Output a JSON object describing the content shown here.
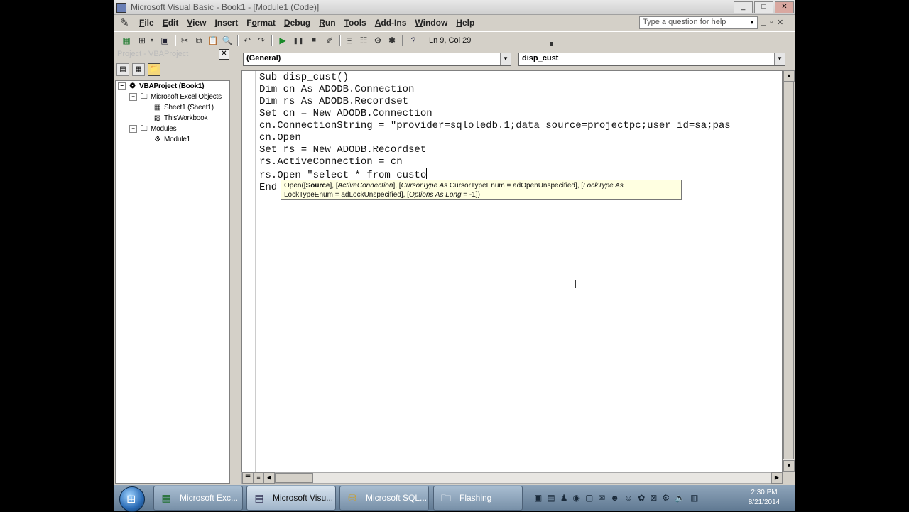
{
  "window": {
    "title": "Microsoft Visual Basic - Book1 - [Module1 (Code)]",
    "controls": [
      "_",
      "□",
      "✕"
    ]
  },
  "menu": {
    "items": [
      {
        "label": "File",
        "key": "F",
        "rest": "ile"
      },
      {
        "label": "Edit",
        "key": "E",
        "rest": "dit"
      },
      {
        "label": "View",
        "key": "V",
        "rest": "iew"
      },
      {
        "label": "Insert",
        "key": "I",
        "rest": "nsert"
      },
      {
        "label": "Format",
        "key": "o",
        "pre": "F",
        "rest": "rmat"
      },
      {
        "label": "Debug",
        "key": "D",
        "rest": "ebug"
      },
      {
        "label": "Run",
        "key": "R",
        "rest": "un"
      },
      {
        "label": "Tools",
        "key": "T",
        "rest": "ools"
      },
      {
        "label": "Add-Ins",
        "key": "A",
        "rest": "dd-Ins"
      },
      {
        "label": "Window",
        "key": "W",
        "rest": "indow"
      },
      {
        "label": "Help",
        "key": "H",
        "rest": "elp"
      }
    ],
    "ask_placeholder": "Type a question for help",
    "mdi_controls": [
      "_",
      "▫",
      "✕"
    ]
  },
  "toolbar": {
    "position": "Ln 9, Col 29"
  },
  "project": {
    "header": "Project - VBAProject",
    "tree": {
      "root": "VBAProject (Book1)",
      "excel_objects": "Microsoft Excel Objects",
      "sheet1": "Sheet1 (Sheet1)",
      "thisworkbook": "ThisWorkbook",
      "modules": "Modules",
      "module1": "Module1"
    }
  },
  "code": {
    "object_combo": "(General)",
    "procedure_combo": "disp_cust",
    "lines": [
      "Sub disp_cust()",
      "Dim cn As ADODB.Connection",
      "Dim rs As ADODB.Recordset",
      "Set cn = New ADODB.Connection",
      "cn.ConnectionString = \"provider=sqloledb.1;data source=projectpc;user id=sa;pas",
      "cn.Open",
      "Set rs = New ADODB.Recordset",
      "rs.ActiveConnection = cn",
      "rs.Open \"select * from custo",
      "End"
    ],
    "tooltip": {
      "p1": "Open([",
      "source": "Source",
      "p2": "], [",
      "active": "ActiveConnection",
      "p3": "], [",
      "cursortype": "CursorType As",
      "p4": " CursorTypeEnum = adOpenUnspecified], [",
      "locktype": "LockType As",
      "line2a": "LockTypeEnum = adLockUnspecified], [",
      "options": "Options As Long",
      "line2b": " = -1])"
    }
  },
  "taskbar": {
    "tasks": [
      {
        "label": "Microsoft Exc...",
        "icon": "excel-icon"
      },
      {
        "label": "Microsoft Visu...",
        "icon": "vba-icon"
      },
      {
        "label": "Microsoft SQL...",
        "icon": "sql-icon"
      },
      {
        "label": "Flashing",
        "icon": "folder-icon"
      }
    ],
    "time": "2:30 PM",
    "date": "8/21/2014"
  },
  "colors": {
    "window_bg": "#d4d0c8",
    "code_bg": "#ffffff",
    "tooltip_bg": "#ffffe1",
    "taskbar": "#7890a8"
  }
}
